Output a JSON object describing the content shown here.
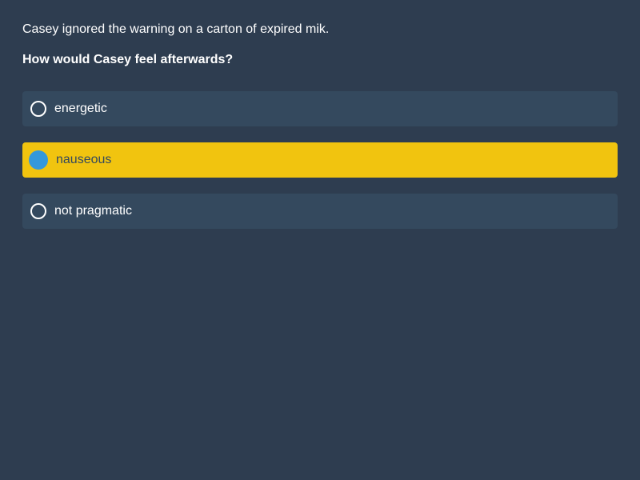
{
  "prompt": {
    "context": "Casey ignored the warning on a carton of expired mik.",
    "question": "How would Casey feel afterwards?"
  },
  "options": [
    {
      "label": "energetic",
      "selected": false
    },
    {
      "label": "nauseous",
      "selected": true
    },
    {
      "label": "not pragmatic",
      "selected": false
    }
  ],
  "colors": {
    "background": "#2e3d50",
    "option_background": "#34495e",
    "selected_background": "#f1c40f",
    "selected_radio": "#3498db"
  }
}
